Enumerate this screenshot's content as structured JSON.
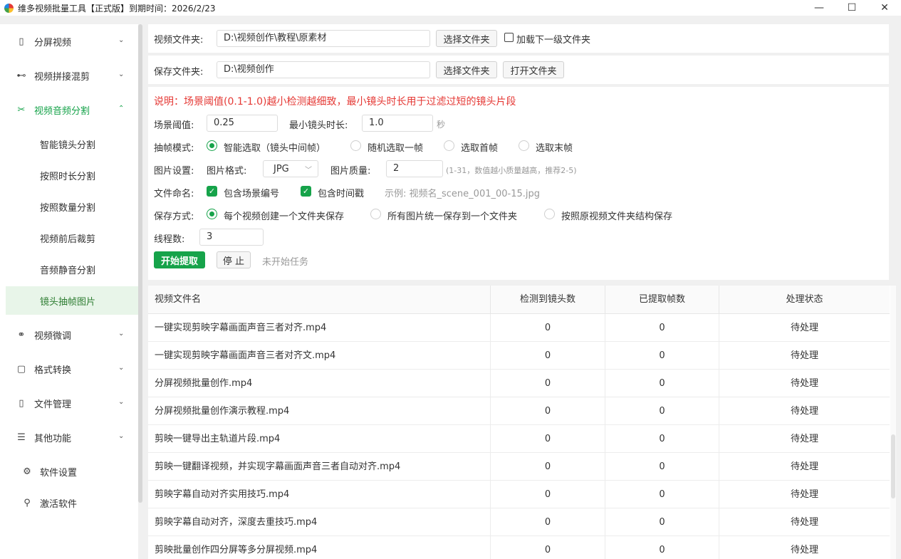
{
  "window": {
    "title": "维多视频批量工具【正式版】到期时间：2026/2/23",
    "minimize": "—",
    "maximize": "☐",
    "close": "✕"
  },
  "sidebar": {
    "menus": [
      {
        "id": "split-screen",
        "label": "分屏视频",
        "icon": "layout-icon",
        "glyph": "▯",
        "chevron": "⌄"
      },
      {
        "id": "splice-mix",
        "label": "视频拼接混剪",
        "icon": "film-strip-icon",
        "glyph": "⊷",
        "chevron": "⌄"
      },
      {
        "id": "av-split",
        "label": "视频音频分割",
        "icon": "scissors-icon",
        "glyph": "✂",
        "chevron": "⌃"
      },
      {
        "id": "fine-tune",
        "label": "视频微调",
        "icon": "link-icon",
        "glyph": "⚭",
        "chevron": "⌄"
      },
      {
        "id": "format",
        "label": "格式转换",
        "icon": "square-icon",
        "glyph": "▢",
        "chevron": "⌄"
      },
      {
        "id": "files",
        "label": "文件管理",
        "icon": "file-icon",
        "glyph": "▯",
        "chevron": "⌄"
      },
      {
        "id": "other",
        "label": "其他功能",
        "icon": "menu-icon",
        "glyph": "☰",
        "chevron": "⌄"
      }
    ],
    "sub_items": [
      "智能镜头分割",
      "按照时长分割",
      "按照数量分割",
      "视频前后裁剪",
      "音频静音分割",
      "镜头抽帧图片"
    ],
    "settings": {
      "label": "软件设置",
      "icon": "gear-icon",
      "glyph": "⚙"
    },
    "activate": {
      "label": "激活软件",
      "icon": "search-icon",
      "glyph": "⚲"
    }
  },
  "video_folder": {
    "label": "视频文件夹:",
    "value": "D:\\视频创作\\教程\\原素材",
    "select_button": "选择文件夹",
    "subfolder_label": "加载下一级文件夹"
  },
  "save_folder": {
    "label": "保存文件夹:",
    "value": "D:\\视频创作",
    "select_button": "选择文件夹",
    "open_button": "打开文件夹"
  },
  "settings": {
    "description": "说明：场景阈值(0.1-1.0)越小检测越细致，最小镜头时长用于过滤过短的镜头片段",
    "threshold_label": "场景阈值:",
    "threshold_value": "0.25",
    "min_shot_label": "最小镜头时长:",
    "min_shot_value": "1.0",
    "min_shot_unit": "秒",
    "frame_mode_label": "抽帧模式:",
    "frame_modes": [
      "智能选取（镜头中间帧）",
      "随机选取一帧",
      "选取首帧",
      "选取末帧"
    ],
    "image_settings_label": "图片设置:",
    "format_label": "图片格式:",
    "format_value": "JPG",
    "quality_label": "图片质量:",
    "quality_value": "2",
    "quality_hint": "(1-31，数值越小质量越高，推荐2-5)",
    "naming_label": "文件命名:",
    "naming_scene": "包含场景编号",
    "naming_time": "包含时间戳",
    "naming_example": "示例: 视频名_scene_001_00-15.jpg",
    "save_mode_label": "保存方式:",
    "save_modes": [
      "每个视频创建一个文件夹保存",
      "所有图片统一保存到一个文件夹",
      "按照原视频文件夹结构保存"
    ],
    "threads_label": "线程数:",
    "threads_value": "3",
    "start_button": "开始提取",
    "stop_button": "停 止",
    "status": "未开始任务"
  },
  "table": {
    "headers": [
      "视频文件名",
      "检测到镜头数",
      "已提取帧数",
      "处理状态"
    ],
    "rows": [
      [
        "一键实现剪映字幕画面声音三者对齐.mp4",
        "0",
        "0",
        "待处理"
      ],
      [
        "一键实现剪映字幕画面声音三者对齐文.mp4",
        "0",
        "0",
        "待处理"
      ],
      [
        "分屏视频批量创作.mp4",
        "0",
        "0",
        "待处理"
      ],
      [
        "分屏视频批量创作演示教程.mp4",
        "0",
        "0",
        "待处理"
      ],
      [
        "剪映一键导出主轨道片段.mp4",
        "0",
        "0",
        "待处理"
      ],
      [
        "剪映一键翻译视频，并实现字幕画面声音三者自动对齐.mp4",
        "0",
        "0",
        "待处理"
      ],
      [
        "剪映字幕自动对齐实用技巧.mp4",
        "0",
        "0",
        "待处理"
      ],
      [
        "剪映字幕自动对齐，深度去重技巧.mp4",
        "0",
        "0",
        "待处理"
      ],
      [
        "剪映批量创作四分屏等多分屏视频.mp4",
        "0",
        "0",
        "待处理"
      ]
    ]
  }
}
